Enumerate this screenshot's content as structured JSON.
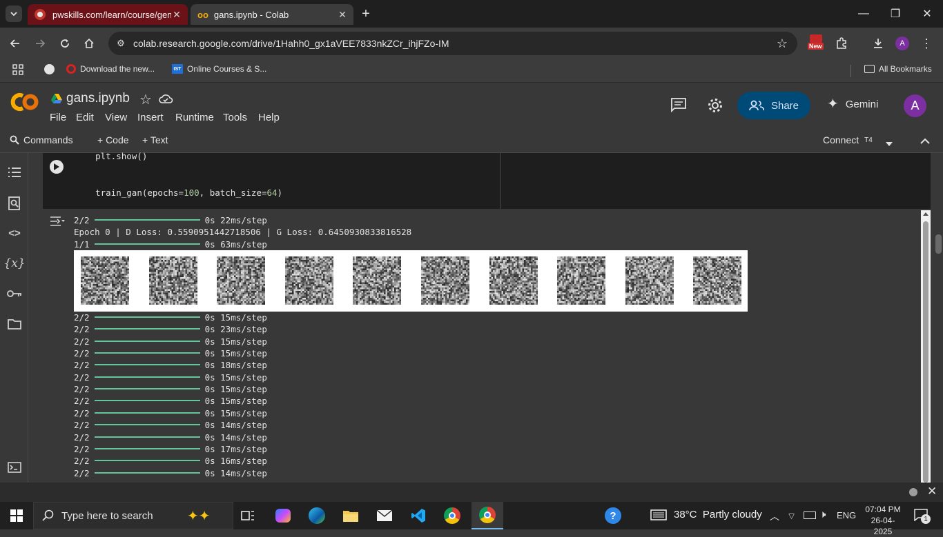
{
  "browser": {
    "tabs": [
      {
        "title": "pwskills.com/learn/course/gena",
        "active": false
      },
      {
        "title": "gans.ipynb - Colab",
        "active": true
      }
    ],
    "url": "colab.research.google.com/drive/1Hahh0_gx1aVEE7833nkZCr_ihjFZo-IM",
    "new_badge": "New",
    "profile_initial": "A",
    "bookmarks": [
      {
        "label": "Download the new..."
      },
      {
        "label": "Online Courses & S..."
      }
    ],
    "all_bookmarks": "All Bookmarks"
  },
  "colab": {
    "logo": "CO",
    "notebook_title": "gans.ipynb",
    "menu": [
      "File",
      "Edit",
      "View",
      "Insert",
      "Runtime",
      "Tools",
      "Help"
    ],
    "share_label": "Share",
    "gemini_label": "Gemini",
    "avatar": "A",
    "commands_label": "Commands",
    "add_code": "+ Code",
    "add_text": "+ Text",
    "connect_label": "Connect",
    "runtime_type": "T4"
  },
  "cell": {
    "code_line1": "    plt.show()",
    "code_line2_fn": "train_gan(",
    "code_line2_args": "epochs=",
    "code_line2_v1": "100",
    "code_line2_sep": ", batch_size=",
    "code_line2_v2": "64",
    "code_line2_end": ")"
  },
  "output": {
    "line1": {
      "prefix": "2/2",
      "suffix": "0s 22ms/step"
    },
    "epoch_line": "Epoch 0 | D Loss: 0.5590951442718506 | G Loss: 0.6450930833816528",
    "line3": {
      "prefix": "1/1",
      "suffix": "0s 63ms/step"
    },
    "image_count": 10,
    "steps": [
      {
        "prefix": "2/2",
        "suffix": "0s 15ms/step"
      },
      {
        "prefix": "2/2",
        "suffix": "0s 23ms/step"
      },
      {
        "prefix": "2/2",
        "suffix": "0s 15ms/step"
      },
      {
        "prefix": "2/2",
        "suffix": "0s 15ms/step"
      },
      {
        "prefix": "2/2",
        "suffix": "0s 18ms/step"
      },
      {
        "prefix": "2/2",
        "suffix": "0s 15ms/step"
      },
      {
        "prefix": "2/2",
        "suffix": "0s 15ms/step"
      },
      {
        "prefix": "2/2",
        "suffix": "0s 15ms/step"
      },
      {
        "prefix": "2/2",
        "suffix": "0s 15ms/step"
      },
      {
        "prefix": "2/2",
        "suffix": "0s 14ms/step"
      },
      {
        "prefix": "2/2",
        "suffix": "0s 14ms/step"
      },
      {
        "prefix": "2/2",
        "suffix": "0s 17ms/step"
      },
      {
        "prefix": "2/2",
        "suffix": "0s 16ms/step"
      },
      {
        "prefix": "2/2",
        "suffix": "0s 14ms/step"
      }
    ]
  },
  "taskbar": {
    "search_placeholder": "Type here to search",
    "weather": "38°C  Partly cloudy",
    "language": "ENG",
    "time": "07:04 PM",
    "date": "26-04-2025",
    "notification_count": "1"
  },
  "colors": {
    "progress_bar": "#63c79b",
    "share_button": "#004a77",
    "avatar": "#7b2fa0",
    "active_tab_bg": "#3c3c3c",
    "other_tab_bg": "#6b1219"
  }
}
